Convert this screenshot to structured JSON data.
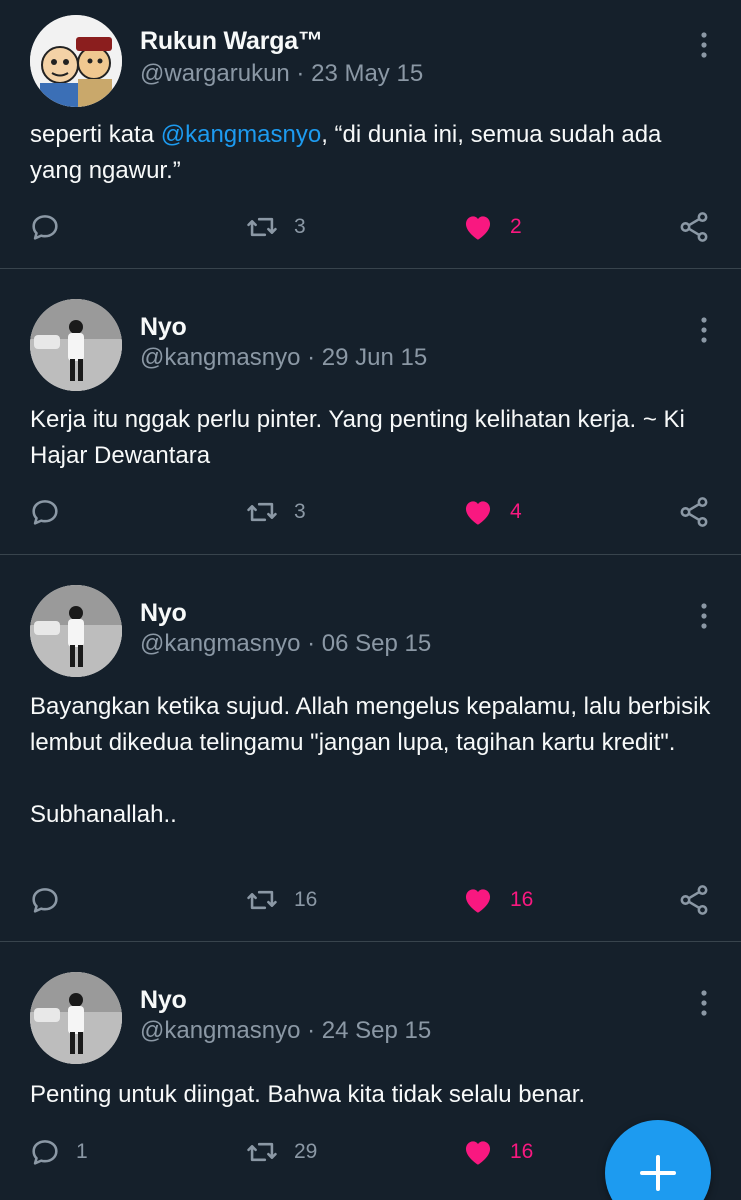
{
  "colors": {
    "background": "#15202b",
    "text": "#f7f9f9",
    "secondary": "#8b98a5",
    "accent": "#1d9bf0",
    "like": "#f91880",
    "divider": "#38444d"
  },
  "tweets": [
    {
      "name": "Rukun Warga™",
      "handle": "@wargarukun",
      "date": "23 May 15",
      "text_before": "seperti kata ",
      "mention": "@kangmasnyo",
      "text_after": ", “di dunia ini, semua sudah ada yang ngawur.”",
      "replies": "",
      "retweets": "3",
      "likes": "2"
    },
    {
      "name": "Nyo",
      "handle": "@kangmasnyo",
      "date": "29 Jun 15",
      "text": "Kerja itu nggak perlu pinter. Yang penting kelihatan kerja. ~ Ki Hajar Dewantara",
      "replies": "",
      "retweets": "3",
      "likes": "4"
    },
    {
      "name": "Nyo",
      "handle": "@kangmasnyo",
      "date": "06 Sep 15",
      "text": "Bayangkan ketika sujud. Allah mengelus kepalamu, lalu berbisik lembut dikedua telingamu \"jangan lupa, tagihan kartu kredit\".\n\nSubhanallah..",
      "replies": "",
      "retweets": "16",
      "likes": "16"
    },
    {
      "name": "Nyo",
      "handle": "@kangmasnyo",
      "date": "24 Sep 15",
      "text": "Penting untuk diingat. Bahwa kita tidak selalu benar.",
      "replies": "1",
      "retweets": "29",
      "likes": "16"
    }
  ],
  "separator": " · ",
  "icons": [
    "reply-icon",
    "retweet-icon",
    "heart-icon",
    "share-icon",
    "more-icon",
    "compose-plus-icon"
  ]
}
